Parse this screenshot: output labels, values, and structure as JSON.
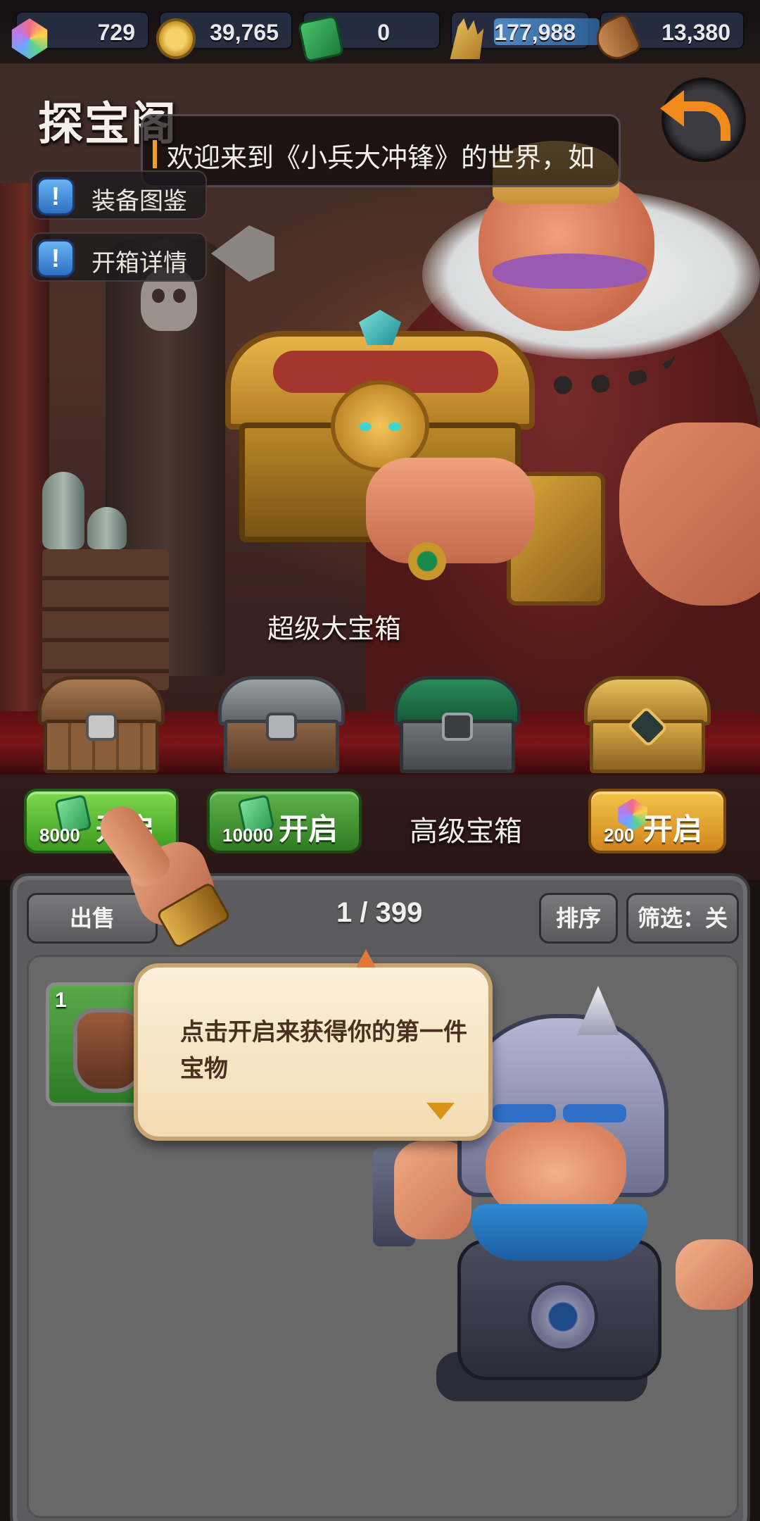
{
  "resources": [
    {
      "icon": "gem-icon",
      "value": "729"
    },
    {
      "icon": "gold-coin-icon",
      "value": "39,765"
    },
    {
      "icon": "green-ticket-icon",
      "value": "0"
    },
    {
      "icon": "wheat-icon",
      "value": "177,988"
    },
    {
      "icon": "wood-log-icon",
      "value": "13,380"
    }
  ],
  "header": {
    "title": "探宝阁",
    "marquee": "欢迎来到《小兵大冲锋》的世界，如",
    "back_icon": "back-arrow-icon"
  },
  "side_buttons": [
    {
      "label": "装备图鉴",
      "icon_char": "!"
    },
    {
      "label": "开箱详情",
      "icon_char": "!"
    }
  ],
  "featured_chest": {
    "name": "超级大宝箱"
  },
  "chests": [
    {
      "kind": "wooden",
      "button_label": "开启",
      "cost": "8000",
      "currency_icon": "green-ticket-icon"
    },
    {
      "kind": "stone",
      "button_label": "开启",
      "cost": "10000",
      "currency_icon": "green-ticket-icon"
    },
    {
      "kind": "advanced",
      "label": "高级宝箱"
    },
    {
      "kind": "golden",
      "button_label": "开启",
      "cost": "200",
      "currency_icon": "gem-icon"
    }
  ],
  "inventory": {
    "sell_label": "出售",
    "count": "1 / 399",
    "sort_label": "排序",
    "filter_label": "筛选：关",
    "items": [
      {
        "level": "1",
        "icon": "armor-icon"
      }
    ]
  },
  "tutorial": {
    "text": "点击开启来获得你的第一件宝物"
  },
  "colors": {
    "open_green": "#5cb83a",
    "open_gold": "#e8a832",
    "panel": "#5c5c5e",
    "bubble": "#f6e6c4"
  }
}
